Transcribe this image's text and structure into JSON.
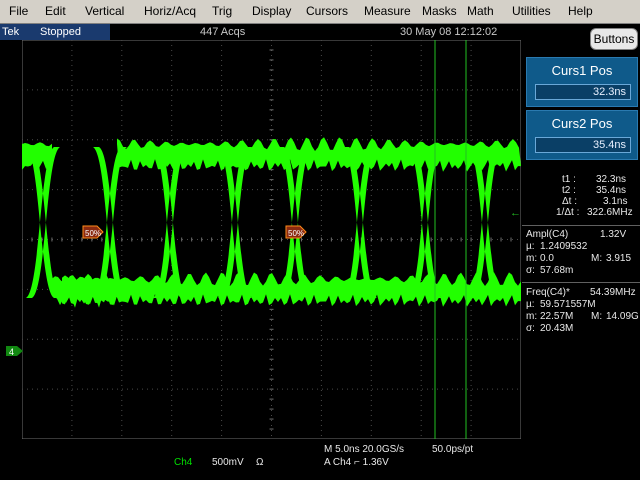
{
  "menu": [
    "File",
    "Edit",
    "Vertical",
    "Horiz/Acq",
    "Trig",
    "Display",
    "Cursors",
    "Measure",
    "Masks",
    "Math",
    "Utilities",
    "Help"
  ],
  "status": {
    "brand": "Tek",
    "state": "Stopped",
    "acqs": "447 Acqs",
    "datetime": "30 May 08 12:12:02"
  },
  "buttons_label": "Buttons",
  "cursor1": {
    "title": "Curs1 Pos",
    "value": "32.3ns"
  },
  "cursor2": {
    "title": "Curs2 Pos",
    "value": "35.4ns"
  },
  "cursor_readouts": {
    "t1_label": "t1 :",
    "t1_value": "32.3ns",
    "t2_label": "t2 :",
    "t2_value": "35.4ns",
    "dt_label": "Δt :",
    "dt_value": "3.1ns",
    "inv_dt_label": "1/Δt :",
    "inv_dt_value": "322.6MHz"
  },
  "meas_ampl": {
    "name": "Ampl(C4)",
    "value": "1.32V",
    "mu_label": "µ:",
    "mu_value": "1.2409532",
    "m_label": "m:",
    "m_value": "0.0",
    "M_label": "M:",
    "M_value": "3.915",
    "sigma_label": "σ:",
    "sigma_value": "57.68m"
  },
  "meas_freq": {
    "name": "Freq(C4)*",
    "value": "54.39MHz",
    "mu_label": "µ:",
    "mu_value": "59.571557M",
    "m_label": "m:",
    "m_value": "22.57M",
    "M_label": "M:",
    "M_value": "14.09G",
    "sigma_label": "σ:",
    "sigma_value": "20.43M"
  },
  "ref_markers": {
    "level1": "50%",
    "level2": "50%",
    "channel_marker": "4",
    "trigger_arrow": "←"
  },
  "bottom": {
    "channel": "Ch4",
    "scale": "500mV",
    "coupling": "Ω",
    "horizontal": "M 5.0ns 20.0GS/s",
    "resolution": "50.0ps/pt",
    "trigger": "A  Ch4  ⌐  1.36V"
  },
  "colors": {
    "waveform": "#22ff00",
    "graticule": "#5a5a5a",
    "cursor": "#22c022",
    "menubar": "#d4d0c8",
    "panel": "#0f5a8a",
    "trigger_marker": "#ff8c1a"
  }
}
